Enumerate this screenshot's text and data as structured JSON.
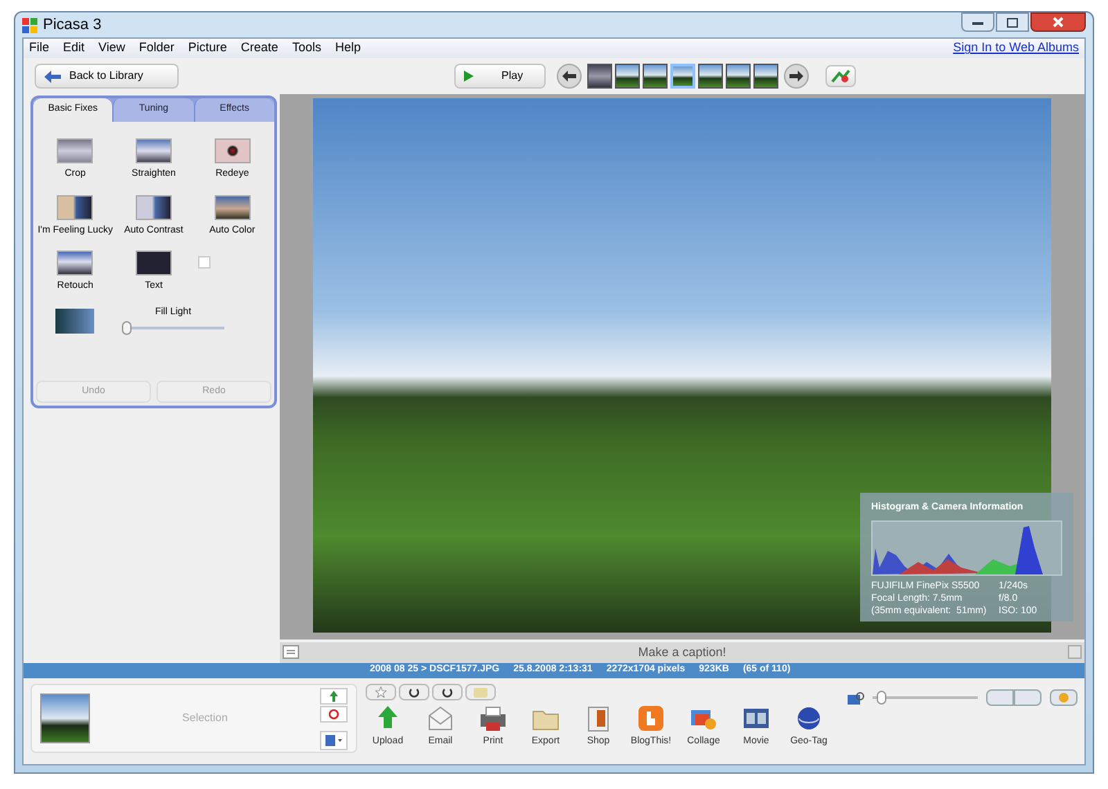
{
  "window": {
    "title": "Picasa 3"
  },
  "menu": [
    "File",
    "Edit",
    "View",
    "Folder",
    "Picture",
    "Create",
    "Tools",
    "Help"
  ],
  "sign_in_link": "Sign In to Web Albums",
  "toolbar": {
    "back_button": "Back to Library",
    "play_button": "Play",
    "filmstrip": [
      {
        "selected": false
      },
      {
        "selected": false
      },
      {
        "selected": false
      },
      {
        "selected": true
      },
      {
        "selected": false
      },
      {
        "selected": false
      },
      {
        "selected": false
      }
    ]
  },
  "edit_panel": {
    "tabs": [
      {
        "label": "Basic Fixes",
        "selected": true
      },
      {
        "label": "Tuning",
        "selected": false
      },
      {
        "label": "Effects",
        "selected": false
      }
    ],
    "tools": [
      {
        "label": "Crop",
        "kind": "crop"
      },
      {
        "label": "Straighten",
        "kind": "straighten"
      },
      {
        "label": "Redeye",
        "kind": "redeye"
      },
      {
        "label": "I'm Feeling Lucky",
        "kind": "lucky"
      },
      {
        "label": "Auto Contrast",
        "kind": "contrast"
      },
      {
        "label": "Auto Color",
        "kind": "color"
      },
      {
        "label": "Retouch",
        "kind": "retouch"
      },
      {
        "label": "Text",
        "kind": "text"
      }
    ],
    "checkbox": {
      "checked": false,
      "disabled": true
    },
    "fill_light": {
      "label": "Fill Light",
      "level": 0.0
    },
    "buttons": [
      {
        "label": "Undo",
        "disabled": true
      },
      {
        "label": "Redo",
        "disabled": true
      }
    ]
  },
  "caption": {
    "placeholder": "Make a caption!"
  },
  "histogram": {
    "title": "Histogram & Camera Information",
    "info": [
      [
        "FUJIFILM FinePix S5500",
        "1/240s"
      ],
      [
        "Focal Length: 7.5mm",
        "f/8.0"
      ],
      [
        "(35mm equivalent:  51mm)",
        "ISO: 100"
      ]
    ]
  },
  "status_bar": [
    "2008 08 25 > DSCF1577.JPG",
    "25.8.2008 2:13:31",
    "2272x1704 pixels",
    "923KB",
    "(65 of 110)"
  ],
  "tray": {
    "label": "Selection"
  },
  "zoom": {
    "level": 0.05
  },
  "actions": [
    {
      "label": "Upload",
      "kind": "upload"
    },
    {
      "label": "Email",
      "kind": "email"
    },
    {
      "label": "Print",
      "kind": "print"
    },
    {
      "label": "Export",
      "kind": "export"
    },
    {
      "label": "Shop",
      "kind": "shop"
    },
    {
      "label": "BlogThis!",
      "kind": "blog"
    },
    {
      "label": "Collage",
      "kind": "collage"
    },
    {
      "label": "Movie",
      "kind": "movie"
    },
    {
      "label": "Geo-Tag",
      "kind": "geotag"
    }
  ]
}
